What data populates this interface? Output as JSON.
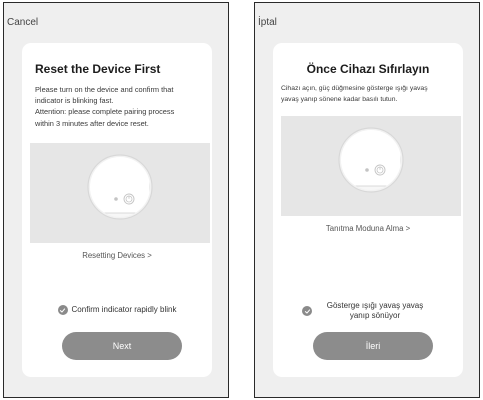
{
  "screens": [
    {
      "nav_back": "Cancel",
      "title": "Reset the Device First",
      "desc_lines": [
        "Please turn on the device and confirm that",
        "indicator is blinking fast.",
        "Attention: please complete pairing process",
        "within 3 minutes after device reset."
      ],
      "link": "Resetting Devices >",
      "confirm": "Confirm indicator rapidly blink",
      "button": "Next"
    },
    {
      "nav_back": "İptal",
      "title": "Önce Cihazı Sıfırlayın",
      "desc_lines": [
        "Cihazı açın, güç düğmesine gösterge ışığı yavaş",
        "yavaş yanıp sönene kadar basılı tutun."
      ],
      "link": "Tanıtma Moduna Alma >",
      "confirm": "Gösterge ışığı yavaş yavaş yanıp sönüyor",
      "button": "İleri"
    }
  ],
  "icons": {
    "device": "device-icon",
    "power": "power-icon",
    "check": "check-circle-icon"
  },
  "colors": {
    "frame_bg": "#efefef",
    "card_bg": "#ffffff",
    "illustration_bg": "#e6e6e6",
    "button_bg": "#8c8c8c",
    "button_text": "#ffffff",
    "check_bg": "#8a8a8a"
  }
}
